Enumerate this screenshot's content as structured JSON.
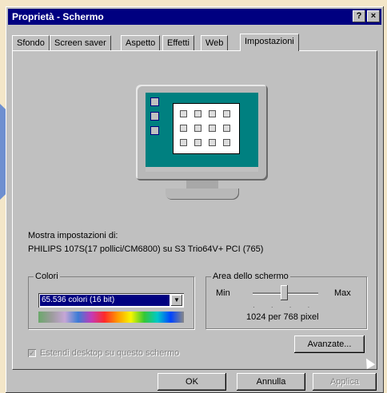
{
  "window": {
    "title": "Proprietà - Schermo",
    "help_label": "?",
    "close_label": "×"
  },
  "tabs": [
    {
      "label": "Sfondo"
    },
    {
      "label": "Screen saver"
    },
    {
      "label": "Aspetto"
    },
    {
      "label": "Effetti"
    },
    {
      "label": "Web"
    },
    {
      "label": "Impostazioni",
      "active": true
    }
  ],
  "settings": {
    "display_label": "Mostra impostazioni di:",
    "display_device": "PHILIPS 107S(17 pollici/CM6800) su S3 Trio64V+ PCI (765)"
  },
  "colors_group": {
    "legend": "Colori",
    "selected_value": "65.536 colori (16 bit)"
  },
  "screen_area": {
    "legend": "Area dello schermo",
    "min_label": "Min",
    "max_label": "Max",
    "resolution": "1024 per 768 pixel"
  },
  "extend_checkbox": {
    "label": "Estendi desktop su questo schermo",
    "checked": true
  },
  "advanced_button": "Avanzate...",
  "buttons": {
    "ok": "OK",
    "cancel": "Annulla",
    "apply": "Applica"
  },
  "colors": {
    "title_bar": "#000080",
    "dialog": "#c0c0c0",
    "desktop": "#008080"
  }
}
